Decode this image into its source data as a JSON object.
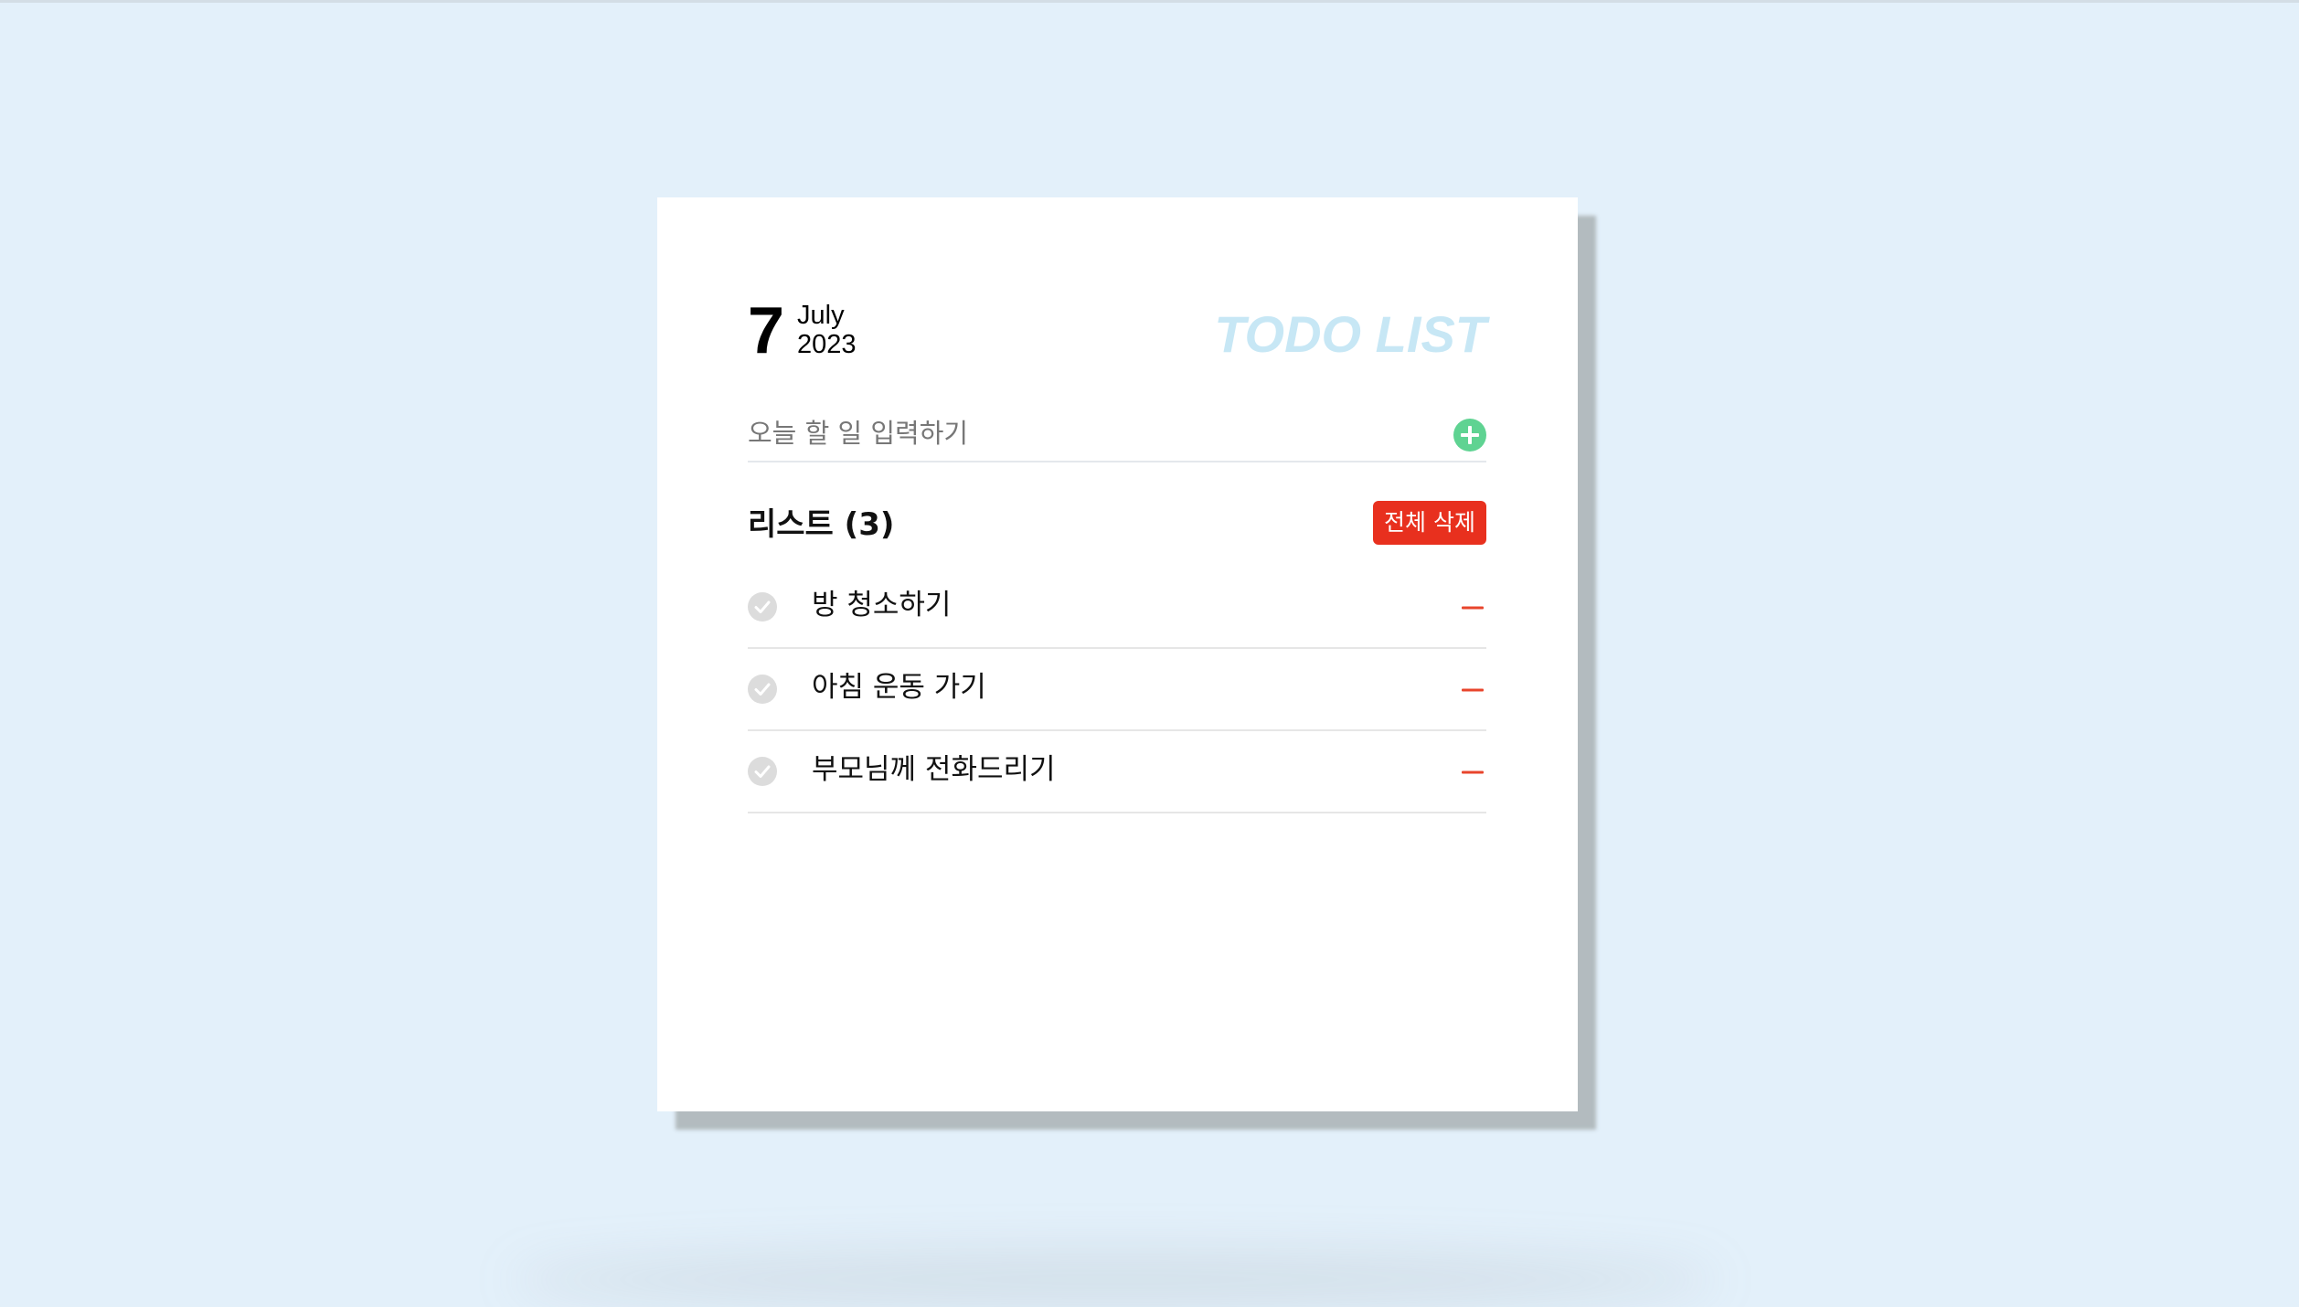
{
  "date": {
    "day": "7",
    "month": "July",
    "year": "2023"
  },
  "app_title": "TODO LIST",
  "input": {
    "placeholder": "오늘 할 일 입력하기",
    "value": "",
    "add_icon": "plus-circle-icon"
  },
  "list": {
    "title": "리스트 (3)",
    "clear_label": "전체 삭제",
    "items": [
      {
        "text": "방 청소하기",
        "checked": false
      },
      {
        "text": "아침 운동 가기",
        "checked": false
      },
      {
        "text": "부모님께 전화드리기",
        "checked": false
      }
    ],
    "check_icon": "check-circle-icon",
    "remove_icon": "minus-icon"
  },
  "colors": {
    "background": "#e3f0fa",
    "title": "#c7e7f5",
    "add_button": "#5fd392",
    "clear_button": "#e8301e",
    "remove_icon": "#e8452c",
    "check_inactive": "#dcdcdc"
  }
}
